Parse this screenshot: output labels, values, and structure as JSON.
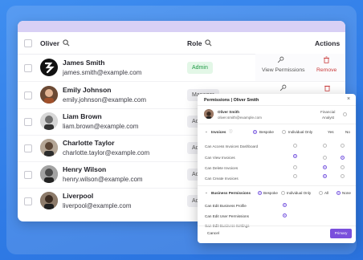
{
  "header": {
    "name_col": "Oliver",
    "role_col": "Role",
    "actions_col": "Actions"
  },
  "rows": [
    {
      "name": "James Smith",
      "email": "james.smith@example.com",
      "role": "Admin"
    },
    {
      "name": "Emily Johnson",
      "email": "emily.johnson@example.com",
      "role": "Manager"
    },
    {
      "name": "Liam Brown",
      "email": "liam.brown@example.com",
      "role": "Ac"
    },
    {
      "name": "Charlotte Taylor",
      "email": "charlotte.taylor@example.com",
      "role": "Ac"
    },
    {
      "name": "Henry Wilson",
      "email": "henry.wilson@example.com",
      "role": "Ac"
    },
    {
      "name": "Liverpool",
      "email": "liverpool@example.com",
      "role": "Ac"
    }
  ],
  "actions": {
    "view_permissions": "View Permissions",
    "remove": "Remove"
  },
  "modal": {
    "title": "Permissions | Oliver Smith",
    "user_name": "Oliver Smith",
    "user_email": "oliver.smith@example.com",
    "user_role_line1": "Financial",
    "user_role_line2": "Analyst",
    "invoices_label": "Invoices",
    "bespoke": "Bespoke",
    "individual_only": "Individual Only",
    "yes": "Yes",
    "no": "No",
    "invoice_perms": [
      "Can Access Invoices Dashboard",
      "Can View Invoices",
      "Can Delete Invoices",
      "Can Create Invoices"
    ],
    "business_label": "Business Permissions",
    "all": "All",
    "none": "None",
    "business_perms": [
      "Can Edit Business Profile",
      "Can Edit User Permissions",
      "Can Edit Business Settings"
    ],
    "cancel": "Cancel",
    "primary": "Primary"
  }
}
